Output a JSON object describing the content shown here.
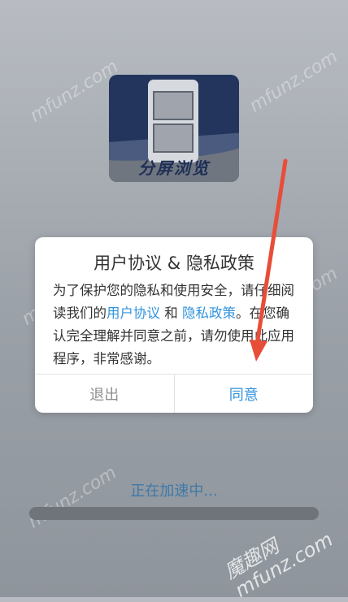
{
  "logo": {
    "text": "分屏浏览"
  },
  "dialog": {
    "title": "用户协议 & 隐私政策",
    "body": {
      "text1": "为了保护您的隐私和使用安全，请仔细阅读我们的",
      "link1": "用户协议",
      "text2": " 和 ",
      "link2": "隐私政策",
      "text3": "。在您确认完全理解并同意之前，请勿使用此应用程序，非常感谢。"
    },
    "buttons": {
      "exit": "退出",
      "agree": "同意"
    }
  },
  "loading": {
    "text": "正在加速中..."
  },
  "watermarks": {
    "site": "mfunz.com",
    "corner_cn": "魔趣网",
    "corner_en": "mfunz.com"
  },
  "colors": {
    "link": "#3193dd",
    "arrow": "#e84d38"
  }
}
